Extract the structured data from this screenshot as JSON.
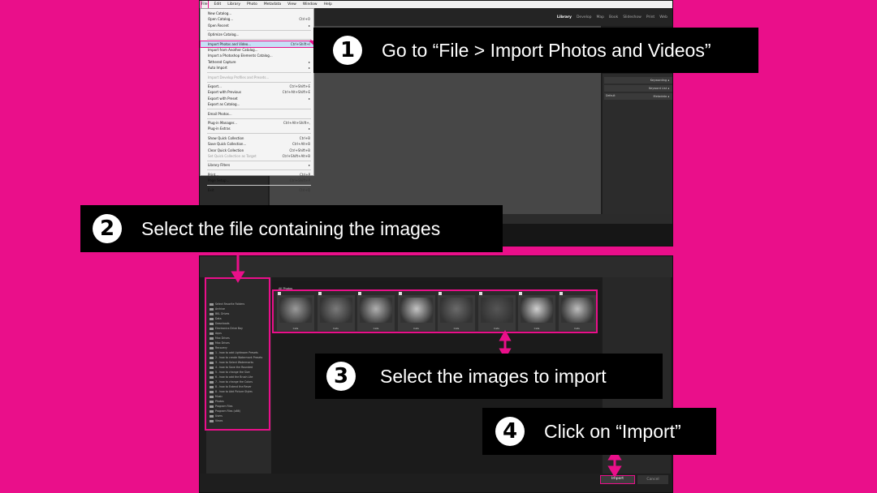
{
  "menu_bar": {
    "items": [
      "File",
      "Edit",
      "Library",
      "Photo",
      "Metadata",
      "View",
      "Window",
      "Help"
    ]
  },
  "modules": [
    "Library",
    "Develop",
    "Map",
    "Book",
    "Slideshow",
    "Print",
    "Web"
  ],
  "file_menu": {
    "items": [
      {
        "label": "New Catalog...",
        "shortcut": "",
        "state": "normal"
      },
      {
        "label": "Open Catalog...",
        "shortcut": "Ctrl+O",
        "state": "normal"
      },
      {
        "label": "Open Recent",
        "shortcut": "▸",
        "state": "normal"
      },
      {
        "label": "",
        "shortcut": "",
        "state": "sep"
      },
      {
        "label": "Optimize Catalog...",
        "shortcut": "",
        "state": "normal"
      },
      {
        "label": "",
        "shortcut": "",
        "state": "sep"
      },
      {
        "label": "Import Photos and Video...",
        "shortcut": "Ctrl+Shift+I",
        "state": "selected"
      },
      {
        "label": "Import from Another Catalog...",
        "shortcut": "",
        "state": "normal"
      },
      {
        "label": "Import a Photoshop Elements Catalog...",
        "shortcut": "",
        "state": "normal"
      },
      {
        "label": "Tethered Capture",
        "shortcut": "▸",
        "state": "normal"
      },
      {
        "label": "Auto Import",
        "shortcut": "▸",
        "state": "normal"
      },
      {
        "label": "",
        "shortcut": "",
        "state": "sep"
      },
      {
        "label": "Import Develop Profiles and Presets...",
        "shortcut": "",
        "state": "disabled"
      },
      {
        "label": "",
        "shortcut": "",
        "state": "sep"
      },
      {
        "label": "Export...",
        "shortcut": "Ctrl+Shift+E",
        "state": "normal"
      },
      {
        "label": "Export with Previous",
        "shortcut": "Ctrl+Alt+Shift+E",
        "state": "normal"
      },
      {
        "label": "Export with Preset",
        "shortcut": "▸",
        "state": "normal"
      },
      {
        "label": "Export as Catalog...",
        "shortcut": "",
        "state": "normal"
      },
      {
        "label": "",
        "shortcut": "",
        "state": "sep"
      },
      {
        "label": "Email Photos...",
        "shortcut": "",
        "state": "normal"
      },
      {
        "label": "",
        "shortcut": "",
        "state": "sep"
      },
      {
        "label": "Plug-in Manager...",
        "shortcut": "Ctrl+Alt+Shift+,",
        "state": "normal"
      },
      {
        "label": "Plug-in Extras",
        "shortcut": "▸",
        "state": "normal"
      },
      {
        "label": "",
        "shortcut": "",
        "state": "sep"
      },
      {
        "label": "Show Quick Collection",
        "shortcut": "Ctrl+B",
        "state": "normal"
      },
      {
        "label": "Save Quick Collection...",
        "shortcut": "Ctrl+Alt+B",
        "state": "normal"
      },
      {
        "label": "Clear Quick Collection",
        "shortcut": "Ctrl+Shift+B",
        "state": "normal"
      },
      {
        "label": "Set Quick Collection as Target",
        "shortcut": "Ctrl+Shift+Alt+B",
        "state": "disabled"
      },
      {
        "label": "",
        "shortcut": "",
        "state": "sep"
      },
      {
        "label": "Library Filters",
        "shortcut": "▸",
        "state": "normal"
      },
      {
        "label": "",
        "shortcut": "",
        "state": "sep"
      },
      {
        "label": "Print...",
        "shortcut": "Ctrl+P",
        "state": "normal"
      },
      {
        "label": "Page Setup...",
        "shortcut": "Ctrl+Shift+P",
        "state": "normal"
      },
      {
        "label": "",
        "shortcut": "",
        "state": "sep"
      },
      {
        "label": "Exit",
        "shortcut": "Ctrl+Q",
        "state": "normal"
      }
    ]
  },
  "right_panel": {
    "keywording": "Keywording ◂",
    "keyword_list": "Keyword List ◂",
    "metadata": "Metadata ◂",
    "default": "Default"
  },
  "source_tree": [
    "Select Favorite Folders",
    "Archive",
    "BKL Drives",
    "Data",
    "Downloads",
    "Electronics Drive Bay",
    "Apps",
    "Max Drives",
    "Max Drives",
    "Recovery",
    "1 - how to add Lightroom Presets",
    "2 - how to create Watermark Presets",
    "3 - how to Select Watermarks",
    "4 - how to Save the Rounded",
    "5 - how to change the Size",
    "6 - how to add the Brush Lite",
    "7 - how to change the Colors",
    "8 - how to Extend the Rever",
    "8 - how to Add Picture Styles",
    "Music",
    "Photos",
    "Program Files",
    "Program Files (x86)",
    "Users",
    "Views"
  ],
  "thumbnails": {
    "header": "All Photos",
    "items": [
      "Cats",
      "Cats",
      "Cats",
      "Cats",
      "Cats",
      "Cats",
      "Cats",
      "Cats"
    ]
  },
  "bottom_buttons": {
    "import": "Import",
    "cancel": "Cancel"
  },
  "callouts": [
    {
      "number": "1",
      "text": "Go to “File > Import Photos and Videos”"
    },
    {
      "number": "2",
      "text": "Select the file containing the images"
    },
    {
      "number": "3",
      "text": "Select the images to import"
    },
    {
      "number": "4",
      "text": "Click on “Import”"
    }
  ],
  "colors": {
    "background": "#ea0f8a",
    "callout": "#000000",
    "highlight": "#ea0f8a"
  }
}
